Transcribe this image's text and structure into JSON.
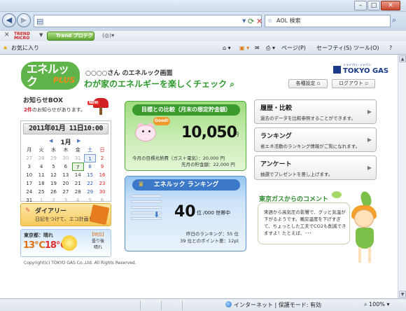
{
  "browser": {
    "search_text": "AOL 検索",
    "trend_toolbar_label": "Trend プロテクト",
    "trend_logo": "TREND MICRO",
    "favorites_label": "お気に入り",
    "menus": {
      "page": "ページ(P)",
      "safety": "セーフティ(S)",
      "tools": "ツール(O)",
      "help": "?"
    },
    "status_zone": "インターネット | 保護モード: 有効",
    "zoom": "100%"
  },
  "site": {
    "logo_text": "エネルック",
    "logo_plus": "PLUS",
    "greeting": "○○○○さん のエネルック画面",
    "slogan": "わが家のエネルギーを楽しくチェック",
    "tg_logo_small": "ミライブロ・ジャパン",
    "tg_logo": "TOKYO GAS",
    "settings_button": "各種設定",
    "logout_button": "ログアウト"
  },
  "notice": {
    "title": "お知らせBOX",
    "count_text": "2件",
    "suffix": "のお知らせがあります。",
    "new_badge": "NEW"
  },
  "calendar": {
    "date_display": "2011年01月 11日10:00",
    "month_label": "1月",
    "prev": "◀",
    "next": "▶",
    "weekdays": [
      "月",
      "火",
      "水",
      "木",
      "金",
      "土",
      "日"
    ],
    "weeks": [
      [
        "27",
        "28",
        "29",
        "30",
        "31",
        "1",
        "2"
      ],
      [
        "3",
        "4",
        "5",
        "6",
        "7",
        "8",
        "9"
      ],
      [
        "10",
        "11",
        "12",
        "13",
        "14",
        "15",
        "16"
      ],
      [
        "17",
        "18",
        "19",
        "20",
        "21",
        "22",
        "23"
      ],
      [
        "24",
        "25",
        "26",
        "27",
        "28",
        "29",
        "30"
      ],
      [
        "31",
        "1",
        "2",
        "3",
        "4",
        "5",
        "6"
      ]
    ]
  },
  "diary": {
    "title": "ダイアリー",
    "text": "日記をつけて、エコ計画！"
  },
  "weather": {
    "city_line": "東京都：晴れ",
    "temp_low": "13℃",
    "temp_high": "18℃",
    "tomorrow_label": "【明日】",
    "tomorrow_text": "曇り後\n晴れ"
  },
  "goal": {
    "title": "目標との比較（月末の想定貯金額）",
    "bubble": "Good!",
    "value": "10,050",
    "unit": "円",
    "line1_label": "今月の目標光熱費（ガス＋電気）：",
    "line1_value": "20,000 円",
    "line2_label": "先月の貯金額：",
    "line2_value": "22,000 円"
  },
  "ranking": {
    "title": "エネルック ランキング",
    "value": "40",
    "unit": "位 /000 世帯中",
    "line1": "昨日のランキング：55 位",
    "line2": "39 位とのポイント差：12pt"
  },
  "menu": [
    {
      "title": "履歴・比較",
      "desc": "過去のデータを比較参照することができます。"
    },
    {
      "title": "ランキング",
      "desc": "省エネ活動のランキング情報がご覧になれます。"
    },
    {
      "title": "アンケート",
      "desc": "抽選でプレゼントを差し上げます。"
    }
  ],
  "comment": {
    "title": "東京ガスからのコメント",
    "text": "来週から高気圧の影響で、グッと気温が下がるようです。暖房温度を下げすぎて、ちょっとした工夫でCO2も削減できますよ！たとえば、･･･"
  },
  "footer": {
    "copyright": "Copyright(c) TOKYO GAS Co.,Ltd. All Rights Reserved."
  },
  "colors": {
    "brand_green": "#3a9a2c",
    "brand_blue": "#3b78c8",
    "tokyo_gas_blue": "#1a3a8a"
  }
}
